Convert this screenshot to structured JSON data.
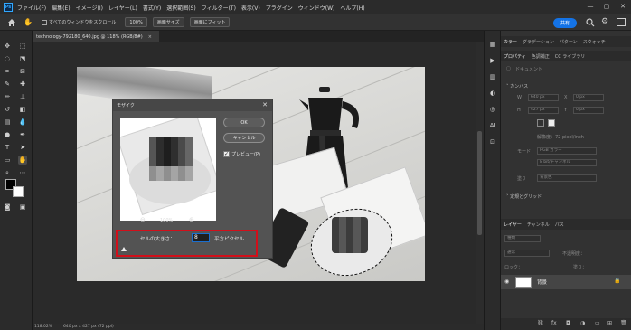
{
  "app": {
    "logo": "Ps"
  },
  "menu": {
    "items": [
      "ファイル(F)",
      "編集(E)",
      "イメージ(I)",
      "レイヤー(L)",
      "書式(Y)",
      "選択範囲(S)",
      "フィルター(T)",
      "表示(V)",
      "プラグイン",
      "ウィンドウ(W)",
      "ヘルプ(H)"
    ]
  },
  "window_controls": {
    "minimize": "—",
    "maximize": "▢",
    "close": "✕"
  },
  "options_bar": {
    "home_icon": "home-icon",
    "hand_tool_icon": "hand-icon",
    "scroll_all_label": "すべてのウィンドウをスクロール",
    "zoom_100": "100%",
    "fit_screen": "画面サイズ",
    "fill_screen": "画面にフィット",
    "share": "共有",
    "search_icon": "search-icon",
    "settings_icon": "gear-icon",
    "panel_icon": "panel-icon"
  },
  "document": {
    "tab_title": "technology-792180_640.jpg @ 118% (RGB/8#)",
    "close": "×",
    "status_zoom": "118.02%",
    "status_size": "640 px x 427 px (72 ppi)"
  },
  "mosaic_dialog": {
    "title": "モザイク",
    "close": "✕",
    "ok": "OK",
    "cancel": "キャンセル",
    "preview_label": "プレビュー(P)",
    "preview_checked": true,
    "zoom_out": "⊖",
    "zoom_level": "100%",
    "zoom_in": "⊕",
    "cell_size_label": "セルの大きさ：",
    "cell_size_value": "8",
    "cell_size_unit": "平方ピクセル",
    "slider_fraction": 0
  },
  "right_panel": {
    "top_tabs": [
      "カラー",
      "グラデーション",
      "パターン",
      "スウォッチ"
    ],
    "prop_tabs": [
      "プロパティ",
      "色調補正",
      "CC ライブラリ"
    ],
    "doc_label": "ドキュメント",
    "canvas_header": "カンバス",
    "w_label": "W",
    "w_value": "640 px",
    "x_label": "X",
    "x_value": "0 px",
    "h_label": "H",
    "h_value": "427 px",
    "y_label": "Y",
    "y_value": "0 px",
    "resolution": "解像度：72 pixel/inch",
    "mode_label": "モード",
    "mode_value": "RGB カラー",
    "depth_value": "8 bit/チャンネル",
    "fill_label": "塗り",
    "fill_value": "背景色",
    "rulers_header": "定規とグリッド",
    "layer_tabs": [
      "レイヤー",
      "チャンネル",
      "パス"
    ],
    "kind_label": "種類",
    "blend_label": "通常",
    "opacity_label": "不透明度：",
    "lock_label": "ロック：",
    "fill2_label": "塗り：",
    "layer_name": "背景"
  }
}
